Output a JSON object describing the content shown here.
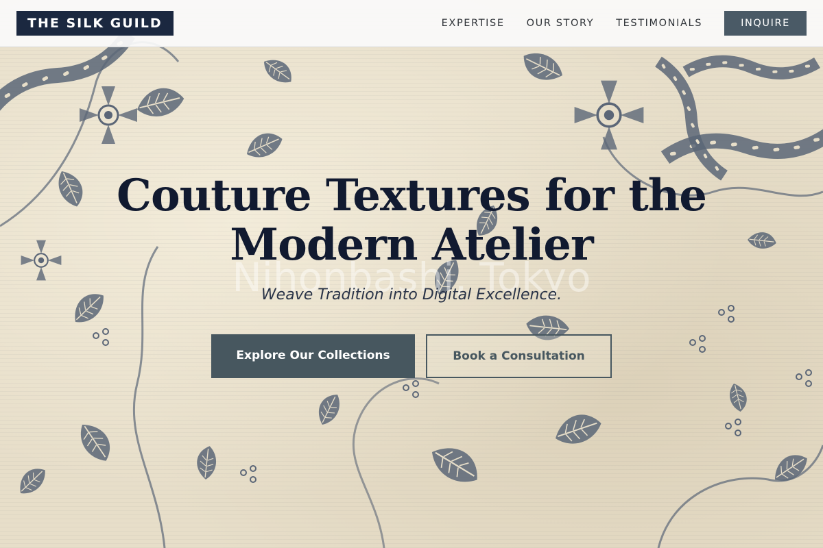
{
  "header": {
    "logo": "THE SILK GUILD",
    "nav": {
      "expertise": "EXPERTISE",
      "our_story": "OUR STORY",
      "testimonials": "TESTIMONIALS"
    },
    "inquire_label": "INQUIRE"
  },
  "hero": {
    "title_line1": "Couture Textures for the",
    "title_line2": "Modern Atelier",
    "background_text": "Nihonbashi, Tokyo",
    "subtitle": "Weave Tradition into Digital Excellence.",
    "primary_cta": "Explore Our Collections",
    "secondary_cta": "Book a Consultation"
  },
  "colors": {
    "navy": "#1b2840",
    "slate": "#47575f",
    "fabric": "#e7dec9",
    "motif": "#5b6677"
  }
}
